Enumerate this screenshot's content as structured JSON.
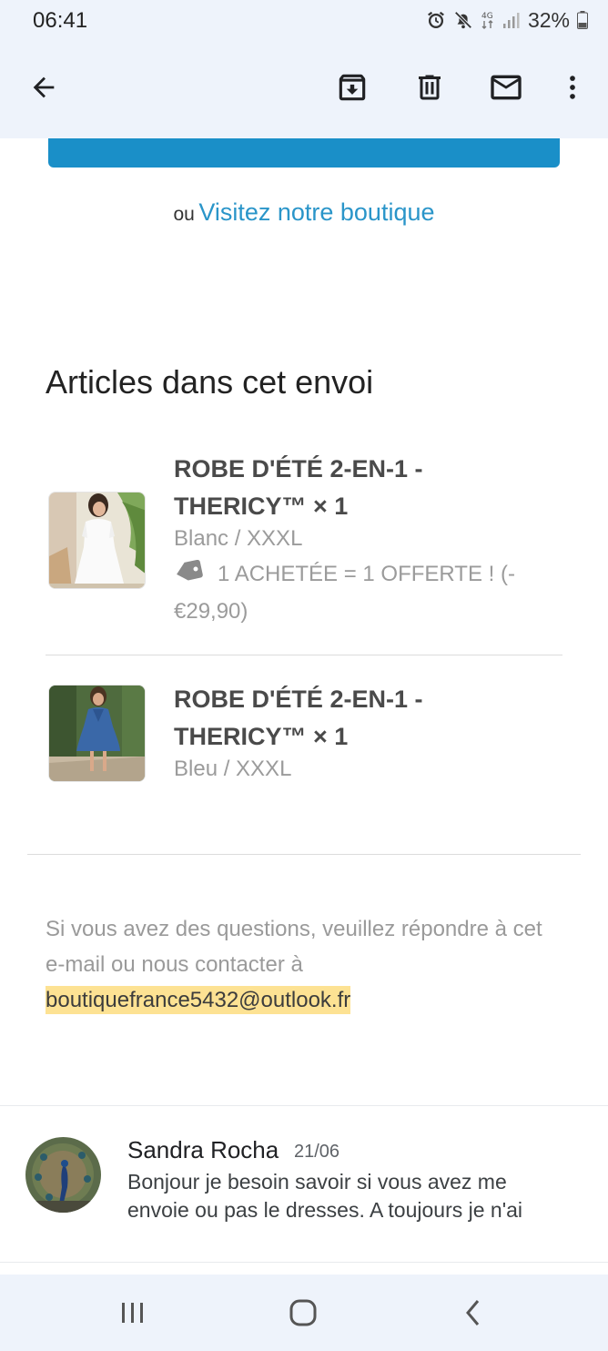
{
  "status": {
    "time": "06:41",
    "battery": "32%",
    "network": "4G",
    "icons": [
      "alarm-icon",
      "mute-icon",
      "network-4g-icon",
      "signal-icon",
      "battery-icon"
    ]
  },
  "toolbar": {
    "icons": [
      "back-arrow-icon",
      "archive-icon",
      "delete-icon",
      "mark-unread-icon",
      "more-vert-icon"
    ]
  },
  "email": {
    "cta_color": "#1a8fc8",
    "alt_prefix": "ou",
    "alt_link": "Visitez notre boutique",
    "section_title": "Articles dans cet envoi",
    "items": [
      {
        "name_line1": "ROBE D'ÉTÉ 2-EN-1 -",
        "name_line2": "THERICY™ × 1",
        "variant": "Blanc / XXXL",
        "promo_line1": "1 ACHETÉE = 1 OFFERTE ! (-",
        "promo_line2": "€29,90)"
      },
      {
        "name_line1": "ROBE D'ÉTÉ 2-EN-1 -",
        "name_line2": "THERICY™ × 1",
        "variant": "Bleu / XXXL"
      }
    ],
    "contact_text": "Si vous avez des questions, veuillez répondre à cet e-mail ou nous contacter à",
    "contact_email": "boutiquefrance5432@outlook.fr"
  },
  "reply": {
    "sender": "Sandra Rocha",
    "date": "21/06",
    "snippet_line1": "Bonjour je besoin savoir si vous avez me",
    "snippet_line2": "envoie ou pas le dresses. A toujours je n'ai"
  },
  "navbar": {
    "icons": [
      "recent-apps-icon",
      "home-icon",
      "back-icon"
    ]
  }
}
